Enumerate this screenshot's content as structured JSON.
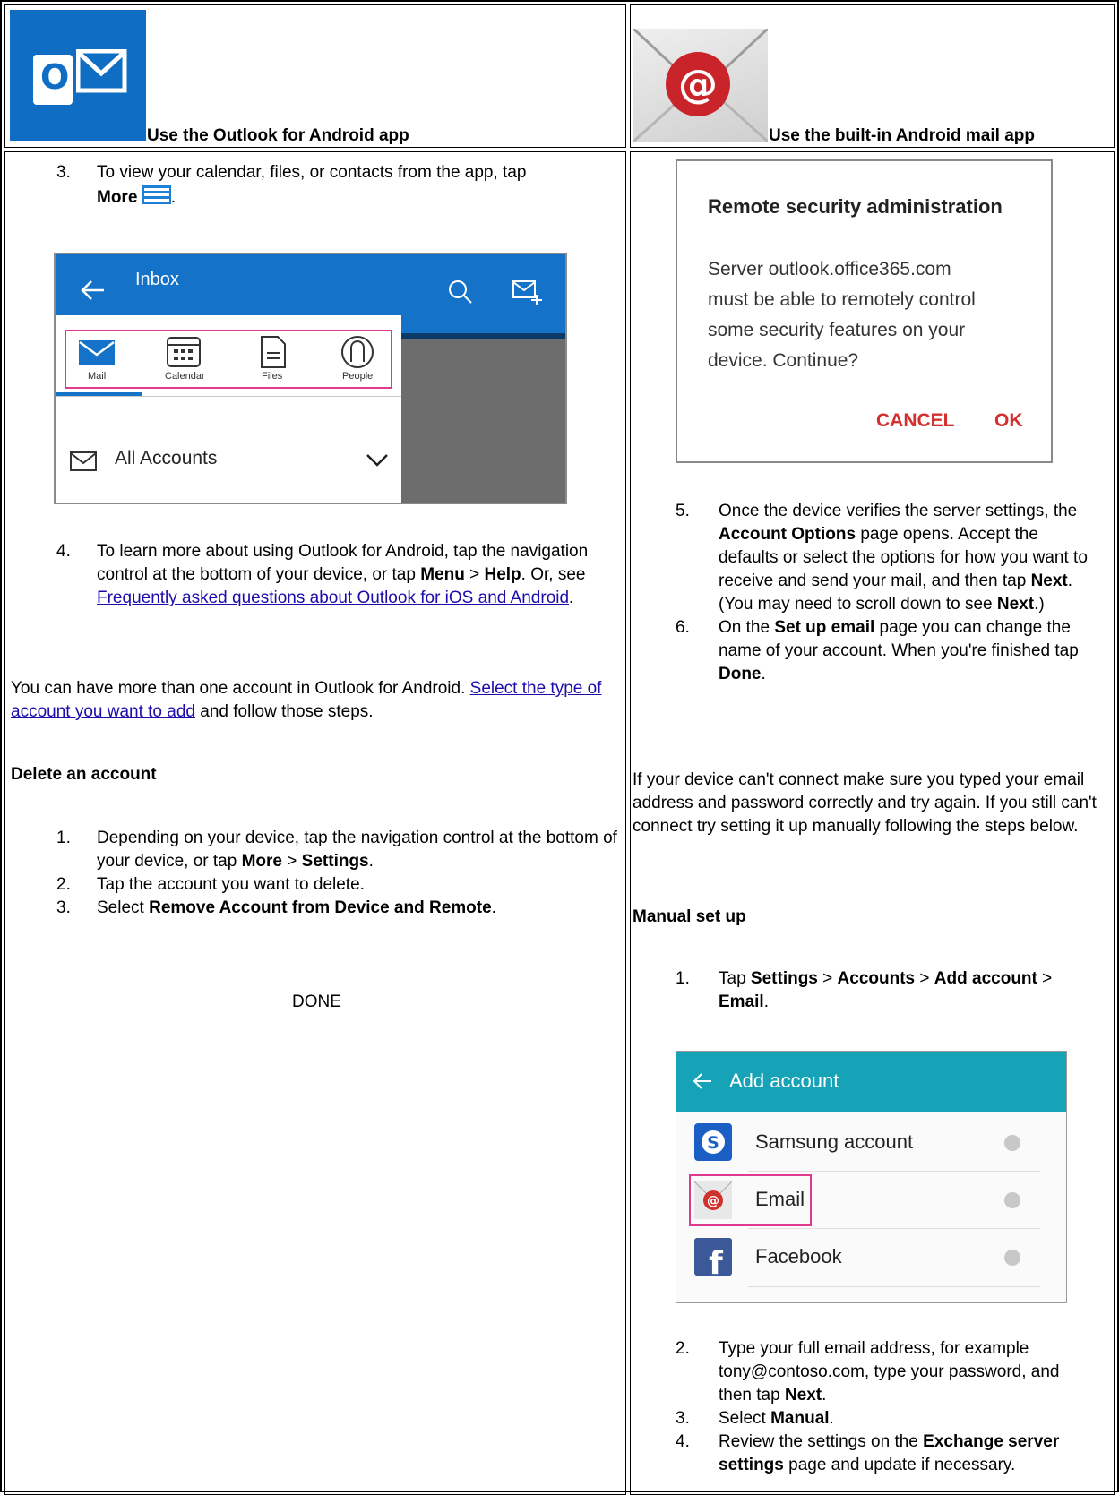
{
  "left_header": {
    "caption": "Use the Outlook for Android app"
  },
  "right_header": {
    "caption": "Use the built-in Android mail app"
  },
  "left": {
    "step3_num": "3.",
    "step3_text": "To view your calendar, files, or contacts from the app, tap",
    "step3_bold": "More",
    "step3_end": ".",
    "inbox_shot": {
      "title": "Inbox",
      "tabs": [
        "Mail",
        "Calendar",
        "Files",
        "People"
      ],
      "all_accounts": "All Accounts"
    },
    "step4_num": "4.",
    "step4_a": "To learn more about using Outlook for Android, tap the navigation control at the bottom of your device, or tap",
    "step4_menu": "Menu",
    "step4_gt": ">",
    "step4_help": "Help",
    "step4_b": ". Or, see",
    "step4_link": "Frequently asked questions about Outlook for iOS and Android",
    "step4_end": ".",
    "multi_a": "You can have more than one account in Outlook for Android.",
    "multi_link": "Select the type of account you want to add",
    "multi_b": "and follow those steps.",
    "delete_heading": "Delete an account",
    "del1_num": "1.",
    "del1_a": "Depending on your device, tap the navigation control at the bottom of your device, or tap",
    "del1_more": "More",
    "del1_gt": ">",
    "del1_settings": "Settings",
    "del1_end": ".",
    "del2_num": "2.",
    "del2": "Tap the account you want to delete.",
    "del3_num": "3.",
    "del3_a": "Select",
    "del3_bold": "Remove Account from Device and Remote",
    "del3_end": ".",
    "done": "DONE"
  },
  "right": {
    "dialog": {
      "title": "Remote security administration",
      "line1": "Server outlook.office365.com",
      "line2": "must be able to remotely control",
      "line3": "some security features on your",
      "line4": "device. Continue?",
      "cancel": "CANCEL",
      "ok": "OK"
    },
    "s5_num": "5.",
    "s5_a": "Once the device verifies the server settings, the",
    "s5_bold": "Account Options",
    "s5_b": "page opens. Accept the defaults or select the options for how you want to receive and send your mail, and then tap",
    "s5_next": "Next",
    "s5_c": ". (You may need to scroll down to see",
    "s5_next2": "Next",
    "s5_d": ".)",
    "s6_num": "6.",
    "s6_a": "On the",
    "s6_bold": "Set up email",
    "s6_b": "page you can change the name of your account. When you're finished tap",
    "s6_done": "Done",
    "s6_end": ".",
    "cant_connect": "If your device can't connect make sure you typed your email address and password correctly and try again. If you still can't connect try setting it up manually following the steps below.",
    "manual_heading": "Manual set up",
    "m1_num": "1.",
    "m1_tap": "Tap",
    "m1_settings": "Settings",
    "m1_gt1": ">",
    "m1_accounts": "Accounts",
    "m1_gt2": ">",
    "m1_add": "Add account",
    "m1_gt3": ">",
    "m1_email": "Email",
    "m1_end": ".",
    "add_shot": {
      "title": "Add account",
      "items": [
        "Samsung account",
        "Email",
        "Facebook"
      ]
    },
    "m2_num": "2.",
    "m2_a": "Type your full email address, for example tony@contoso.com, type your password, and then tap",
    "m2_next": "Next",
    "m2_end": ".",
    "m3_num": "3.",
    "m3_a": "Select",
    "m3_bold": "Manual",
    "m3_end": ".",
    "m4_num": "4.",
    "m4_a": "Review the settings on the",
    "m4_bold": "Exchange server settings",
    "m4_b": "page and update if necessary."
  },
  "colors": {
    "outlook_blue": "#0f6dc3",
    "highlight_pink": "#e0398f",
    "dialog_red": "#d32f2f",
    "android_teal": "#16a3b8",
    "link": "#1a0dab"
  }
}
